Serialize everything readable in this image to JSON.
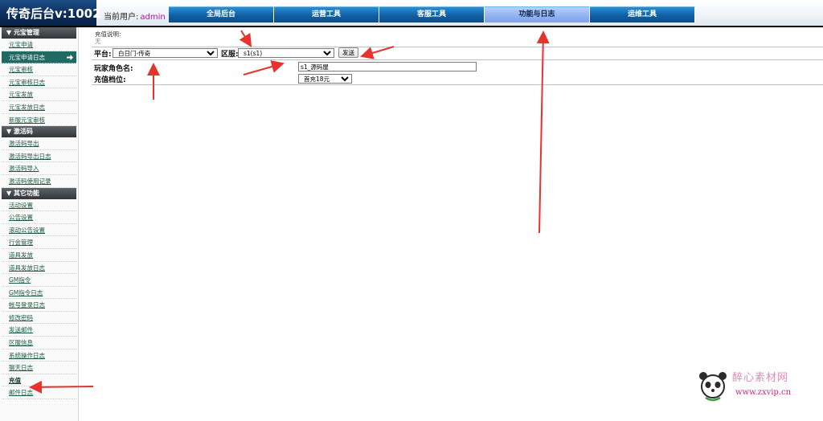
{
  "header": {
    "title": "传奇后台v:1002",
    "current_user_label": "当前用户:",
    "username": "admin"
  },
  "nav": {
    "tabs": [
      {
        "label": "全局后台",
        "active": false
      },
      {
        "label": "运营工具",
        "active": false
      },
      {
        "label": "客服工具",
        "active": false
      },
      {
        "label": "功能与日志",
        "active": true
      },
      {
        "label": "运维工具",
        "active": false
      }
    ]
  },
  "sidebar": {
    "groups": [
      {
        "title": "▼ 元宝管理",
        "items": [
          "元宝申请",
          "元宝申请日志",
          "元宝审核",
          "元宝审核日志",
          "元宝发放",
          "元宝发放日志",
          "新服元宝审核"
        ]
      },
      {
        "title": "▼ 激活码",
        "items": [
          "激活码导出",
          "激活码导出日志",
          "激活码导入",
          "激活码使用记录"
        ]
      },
      {
        "title": "▼ 其它功能",
        "items": [
          "活动设置",
          "公告设置",
          "滚动公告设置",
          "行会管理",
          "道具发放",
          "道具发放日志",
          "GM指令",
          "GM指令日志",
          "帐号登录日志",
          "修改密码",
          "发送邮件",
          "区服信息",
          "系统操作日志",
          "聊天日志",
          "充值",
          "邮件日志"
        ]
      }
    ],
    "active_item": "元宝申请日志",
    "highlight_item": "充值"
  },
  "main": {
    "recharge_desc_label": "充值说明:",
    "recharge_desc_value": "无",
    "platform_label": "平台:",
    "platform_value": "白日门-传奇",
    "server_label": "区服:",
    "server_value": "s1(s1)",
    "send_button": "发送",
    "player_name_label": "玩家角色名:",
    "player_name_value": "s1_源码屋",
    "tier_label": "充值档位:",
    "tier_value": "首充18元"
  },
  "watermark": {
    "line1": "醉心素材网",
    "line2": "www.zxvip.cn"
  },
  "colors": {
    "header_dark": "#0c2f5c",
    "nav_blue": "#0f5fa3",
    "nav_active": "#8fb1f2",
    "sidebar_active": "#1f6b61",
    "link_green": "#1c5a3c",
    "arrow_red": "#e8332c",
    "username": "#d100a8"
  }
}
